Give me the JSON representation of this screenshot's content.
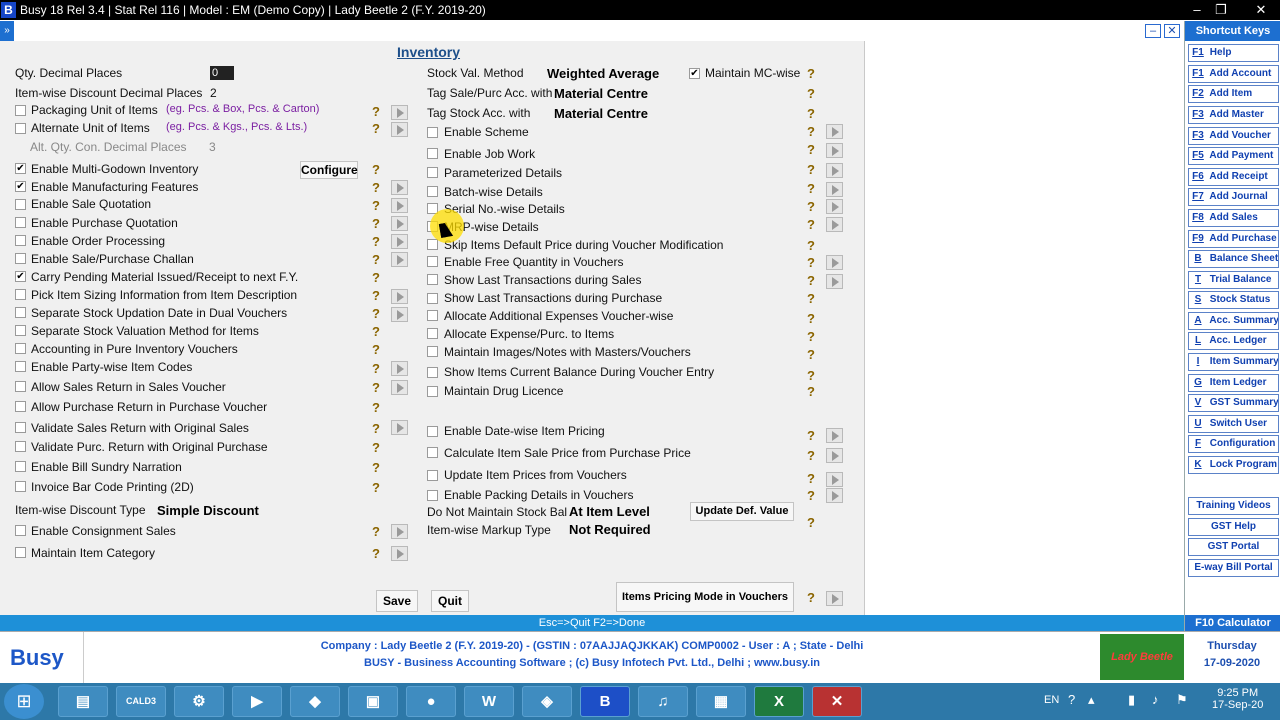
{
  "title_bar": {
    "text": "Busy 18  Rel 3.4   |   Stat Rel 116   |  Model : EM (Demo Copy)   |   Lady Beetle 2 (F.Y. 2019-20)",
    "logo": "B"
  },
  "window_title": "Inventory",
  "left": {
    "qty_decimal_places_label": "Qty. Decimal Places",
    "qty_decimal_places_value": "0",
    "itemwise_discount_decimal_label": "Item-wise Discount Decimal Places",
    "itemwise_discount_decimal_value": "2",
    "packaging_unit": "Packaging Unit of Items",
    "packaging_hint": "(eg. Pcs. & Box, Pcs. & Carton)",
    "alternate_unit": "Alternate Unit of Items",
    "alternate_hint": "(eg. Pcs. & Kgs., Pcs. & Lts.)",
    "alt_qty_label": "Alt. Qty. Con. Decimal Places",
    "alt_qty_value": "3",
    "multi_godown": "Enable Multi-Godown Inventory",
    "configure": "Configure",
    "manufacturing": "Enable Manufacturing Features",
    "sale_quotation": "Enable Sale Quotation",
    "purchase_quotation": "Enable Purchase Quotation",
    "order_processing": "Enable Order Processing",
    "sale_purchase_challan": "Enable Sale/Purchase Challan",
    "carry_pending": "Carry Pending Material Issued/Receipt to next F.Y.",
    "pick_item_sizing": "Pick Item Sizing Information from Item Description",
    "separate_stock_date": "Separate Stock Updation Date in Dual Vouchers",
    "separate_stock_valuation": "Separate Stock Valuation Method for Items",
    "accounting_pure_inventory": "Accounting in Pure Inventory Vouchers",
    "party_wise_codes": "Enable Party-wise Item Codes",
    "allow_sales_return": "Allow Sales Return in Sales Voucher",
    "allow_purchase_return": "Allow Purchase Return in Purchase Voucher",
    "validate_sales_return": "Validate Sales Return with Original Sales",
    "validate_purc_return": "Validate Purc. Return with Original Purchase",
    "bill_sundry_narration": "Enable Bill Sundry Narration",
    "invoice_bar_code": "Invoice Bar Code Printing (2D)",
    "itemwise_discount_type_label": "Item-wise Discount Type",
    "itemwise_discount_type_value": "Simple Discount",
    "consignment_sales": "Enable Consignment Sales",
    "maintain_item_category": "Maintain Item Category"
  },
  "right": {
    "stock_val_method_label": "Stock Val. Method",
    "stock_val_method_value": "Weighted Average",
    "maintain_mc_wise": "Maintain MC-wise",
    "tag_sale_purc_label": "Tag Sale/Purc Acc. with",
    "tag_sale_purc_value": "Material Centre",
    "tag_stock_label": "Tag Stock Acc. with",
    "tag_stock_value": "Material Centre",
    "enable_scheme": "Enable Scheme",
    "enable_job_work": "Enable Job Work",
    "parameterized_details": "Parameterized Details",
    "batch_wise_details": "Batch-wise Details",
    "serial_no_details": "Serial No.-wise Details",
    "mrp_wise_details": "MRP-wise Details",
    "skip_items_default_price": "Skip Items Default Price during Voucher Modification",
    "enable_free_quantity": "Enable Free Quantity in Vouchers",
    "show_last_sales": "Show Last Transactions during Sales",
    "show_last_purchase": "Show Last Transactions during Purchase",
    "allocate_additional": "Allocate Additional  Expenses Voucher-wise",
    "allocate_expense": "Allocate Expense/Purc. to Items",
    "maintain_images": "Maintain Images/Notes with Masters/Vouchers",
    "show_items_balance": "Show Items Current Balance During Voucher Entry",
    "maintain_drug_licence": "Maintain Drug Licence",
    "date_wise_pricing": "Enable Date-wise Item Pricing",
    "calc_sale_price": "Calculate Item Sale Price from Purchase Price",
    "update_item_prices": "Update Item Prices from Vouchers",
    "packing_details": "Enable Packing Details in Vouchers",
    "do_not_maintain_label": "Do Not Maintain Stock Bal",
    "do_not_maintain_value": "At Item Level",
    "update_def_value": "Update Def. Value",
    "markup_type_label": "Item-wise Markup Type",
    "markup_type_value": "Not Required"
  },
  "buttons": {
    "save": "Save",
    "quit": "Quit",
    "items_pricing": "Items Pricing Mode in Vouchers"
  },
  "status_bar": "Esc=>Quit    F2=>Done",
  "sidebar": {
    "header": "Shortcut Keys",
    "items": [
      {
        "key": "F1",
        "label": "Help"
      },
      {
        "key": "F1",
        "label": "Add Account"
      },
      {
        "key": "F2",
        "label": "Add Item"
      },
      {
        "key": "F3",
        "label": "Add Master"
      },
      {
        "key": "F3",
        "label": "Add Voucher"
      },
      {
        "key": "F5",
        "label": "Add Payment"
      },
      {
        "key": "F6",
        "label": "Add Receipt"
      },
      {
        "key": "F7",
        "label": "Add Journal"
      },
      {
        "key": "F8",
        "label": "Add Sales"
      },
      {
        "key": "F9",
        "label": "Add Purchase"
      },
      {
        "key": "B",
        "label": "Balance Sheet"
      },
      {
        "key": "T",
        "label": "Trial Balance"
      },
      {
        "key": "S",
        "label": "Stock Status"
      },
      {
        "key": "A",
        "label": "Acc. Summary"
      },
      {
        "key": "L",
        "label": "Acc. Ledger"
      },
      {
        "key": "I",
        "label": "Item Summary"
      },
      {
        "key": "G",
        "label": "Item Ledger"
      },
      {
        "key": "V",
        "label": "GST Summary"
      },
      {
        "key": "U",
        "label": "Switch User"
      },
      {
        "key": "F",
        "label": "Configuration"
      },
      {
        "key": "K",
        "label": "Lock Program"
      }
    ],
    "extra": [
      "Training Videos",
      "GST Help",
      "GST Portal",
      "E-way Bill Portal"
    ],
    "footer": "F10 Calculator"
  },
  "company": {
    "line1": "Company : Lady Beetle 2 (F.Y. 2019-20) - (GSTIN : 07AAJJAQJKKAK) COMP0002 - User : A ; State - Delhi",
    "line2": "BUSY - Business Accounting Software  ;  (c) Busy Infotech Pvt. Ltd., Delhi  ;  www.busy.in",
    "brand": "Busy",
    "lb_logo": "Lady Beetle",
    "day": "Thursday",
    "date": "17-09-2020"
  },
  "taskbar": {
    "lang": "EN",
    "time": "9:25 PM",
    "date": "17-Sep-20",
    "calc_label": "CALD3"
  },
  "colors": {
    "accent": "#1d6fd0",
    "status": "#1e90d8",
    "link": "#1040b0"
  }
}
